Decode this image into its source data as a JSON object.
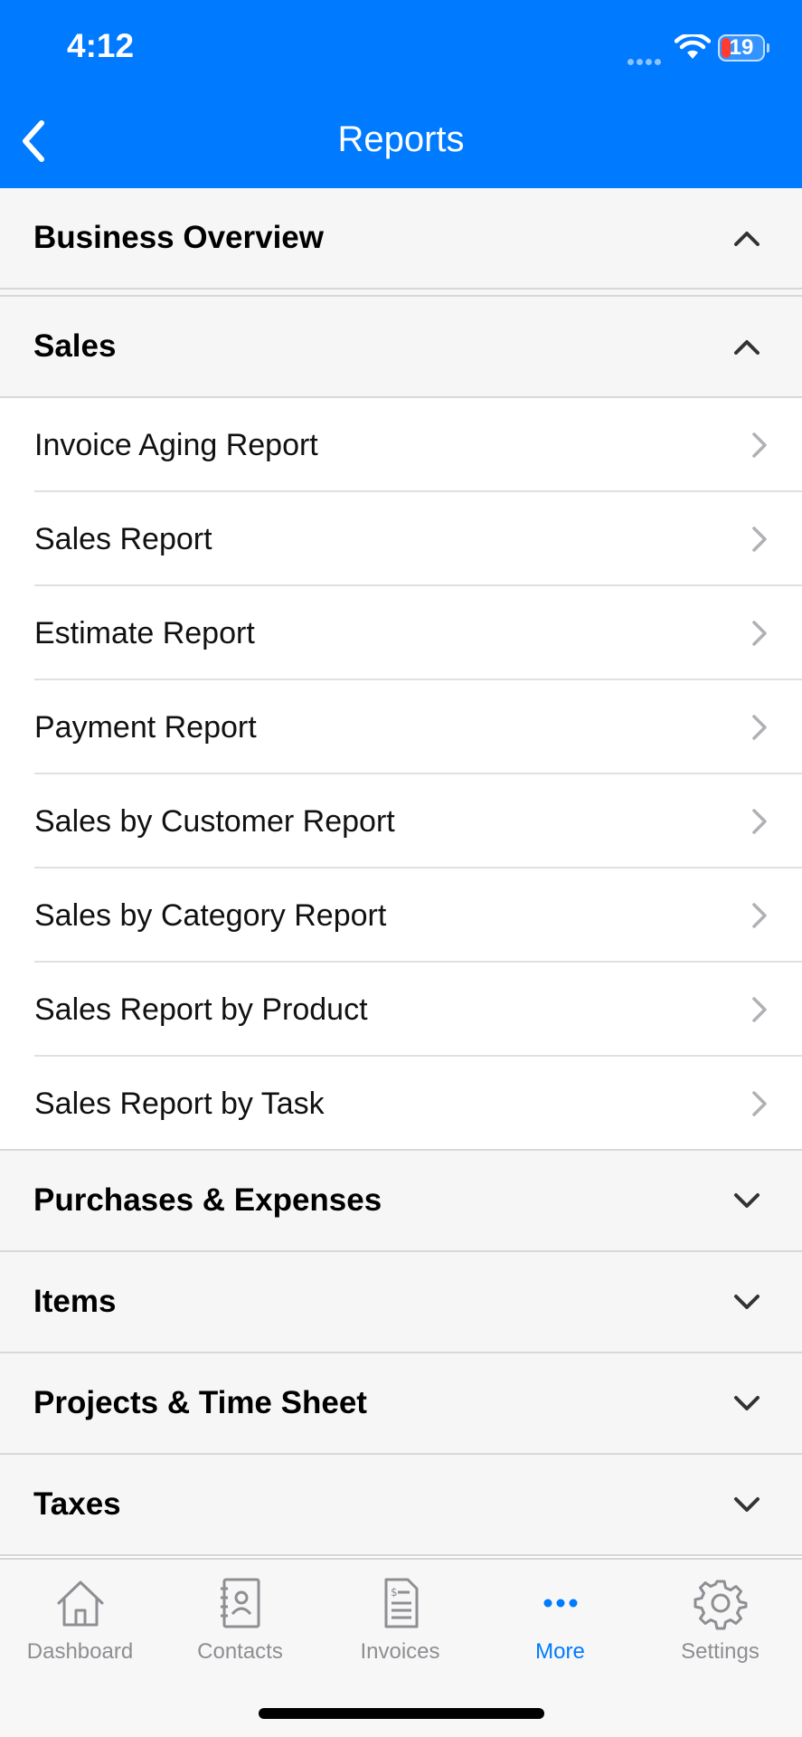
{
  "status_bar": {
    "time": "4:12",
    "battery": "19"
  },
  "nav": {
    "title": "Reports"
  },
  "sections": {
    "business_overview": {
      "label": "Business Overview",
      "state": "expanded"
    },
    "sales": {
      "label": "Sales",
      "state": "expanded",
      "items": [
        "Invoice Aging Report",
        "Sales Report",
        "Estimate Report",
        "Payment Report",
        "Sales by Customer Report",
        "Sales by Category Report",
        "Sales Report by Product",
        "Sales Report by Task"
      ]
    },
    "purchases": {
      "label": "Purchases & Expenses",
      "state": "collapsed"
    },
    "items": {
      "label": "Items",
      "state": "collapsed"
    },
    "projects": {
      "label": "Projects & Time Sheet",
      "state": "collapsed"
    },
    "taxes": {
      "label": "Taxes",
      "state": "collapsed"
    }
  },
  "tabbar": {
    "tabs": [
      {
        "label": "Dashboard",
        "icon": "house-icon"
      },
      {
        "label": "Contacts",
        "icon": "contacts-book-icon"
      },
      {
        "label": "Invoices",
        "icon": "invoice-document-icon"
      },
      {
        "label": "More",
        "icon": "more-dots-icon"
      },
      {
        "label": "Settings",
        "icon": "gear-icon"
      }
    ],
    "active": "More"
  },
  "colors": {
    "accent": "#007aff",
    "header_bg": "#007aff",
    "section_bg": "#f6f6f6",
    "tab_inactive": "#8e8e93",
    "battery_low": "#ff3b30"
  }
}
